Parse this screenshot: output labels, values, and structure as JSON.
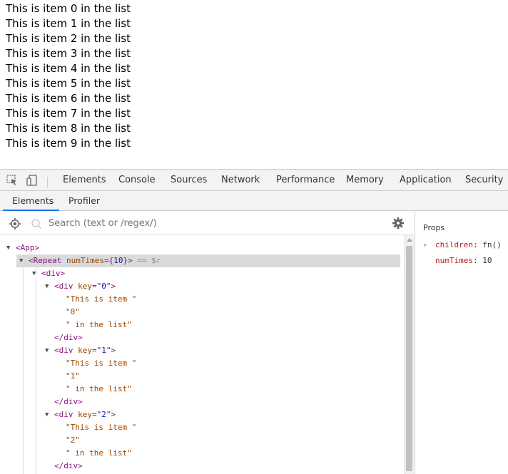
{
  "page": {
    "list_items": [
      "This is item 0 in the list",
      "This is item 1 in the list",
      "This is item 2 in the list",
      "This is item 3 in the list",
      "This is item 4 in the list",
      "This is item 5 in the list",
      "This is item 6 in the list",
      "This is item 7 in the list",
      "This is item 8 in the list",
      "This is item 9 in the list"
    ]
  },
  "devtools": {
    "tabs": [
      "Elements",
      "Console",
      "Sources",
      "Network",
      "Performance",
      "Memory",
      "Application",
      "Security"
    ],
    "subtabs": [
      "Elements",
      "Profiler"
    ],
    "search": {
      "placeholder": "Search (text or /regex/)"
    },
    "tree": {
      "app": "<App>",
      "repeat_open": "<Repeat ",
      "repeat_attr": "numTimes",
      "repeat_eq": "={",
      "repeat_val": "10",
      "repeat_close": "}>",
      "repeat_suffix": " == $r",
      "div_open": "<div>",
      "div_close": "</div>",
      "children": [
        {
          "open": "<div ",
          "attr": "key",
          "eq": "=",
          "val": "\"0\"",
          "close": ">",
          "lines": [
            "\"This is item \"",
            "\"0\"",
            "\" in the list\""
          ]
        },
        {
          "open": "<div ",
          "attr": "key",
          "eq": "=",
          "val": "\"1\"",
          "close": ">",
          "lines": [
            "\"This is item \"",
            "\"1\"",
            "\" in the list\""
          ]
        },
        {
          "open": "<div ",
          "attr": "key",
          "eq": "=",
          "val": "\"2\"",
          "close": ">",
          "lines": [
            "\"This is item \"",
            "\"2\"",
            "\" in the list\""
          ]
        }
      ]
    },
    "props": {
      "title": "Props",
      "items": [
        {
          "key": "children",
          "value": "fn()"
        },
        {
          "key": "numTimes",
          "value": "10"
        }
      ]
    },
    "colors": {
      "accent": "#1a73e8",
      "tag": "#881280",
      "attr": "#994500",
      "string": "#c41a16"
    }
  }
}
